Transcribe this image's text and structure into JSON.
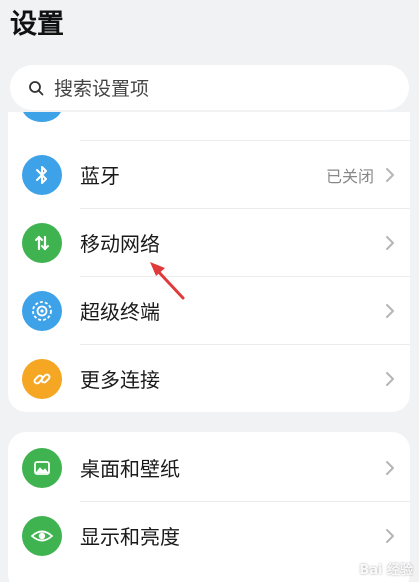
{
  "header": {
    "title": "设置"
  },
  "search": {
    "placeholder": "搜索设置项"
  },
  "groups": [
    {
      "items": [
        {
          "label": "蓝牙",
          "value": "已关闭",
          "icon": "bluetooth-icon",
          "color": "#3ea2e8"
        },
        {
          "label": "移动网络",
          "value": "",
          "icon": "mobile-network-icon",
          "color": "#3fb34f"
        },
        {
          "label": "超级终端",
          "value": "",
          "icon": "super-device-icon",
          "color": "#3ea2e8"
        },
        {
          "label": "更多连接",
          "value": "",
          "icon": "link-icon",
          "color": "#f5a623"
        }
      ]
    },
    {
      "items": [
        {
          "label": "桌面和壁纸",
          "value": "",
          "icon": "wallpaper-icon",
          "color": "#3fb34f"
        },
        {
          "label": "显示和亮度",
          "value": "",
          "icon": "eye-icon",
          "color": "#3fb34f"
        }
      ]
    }
  ],
  "annotation": {
    "arrow_color": "#e03a3a"
  },
  "watermark": {
    "text": "Bai 经验"
  }
}
